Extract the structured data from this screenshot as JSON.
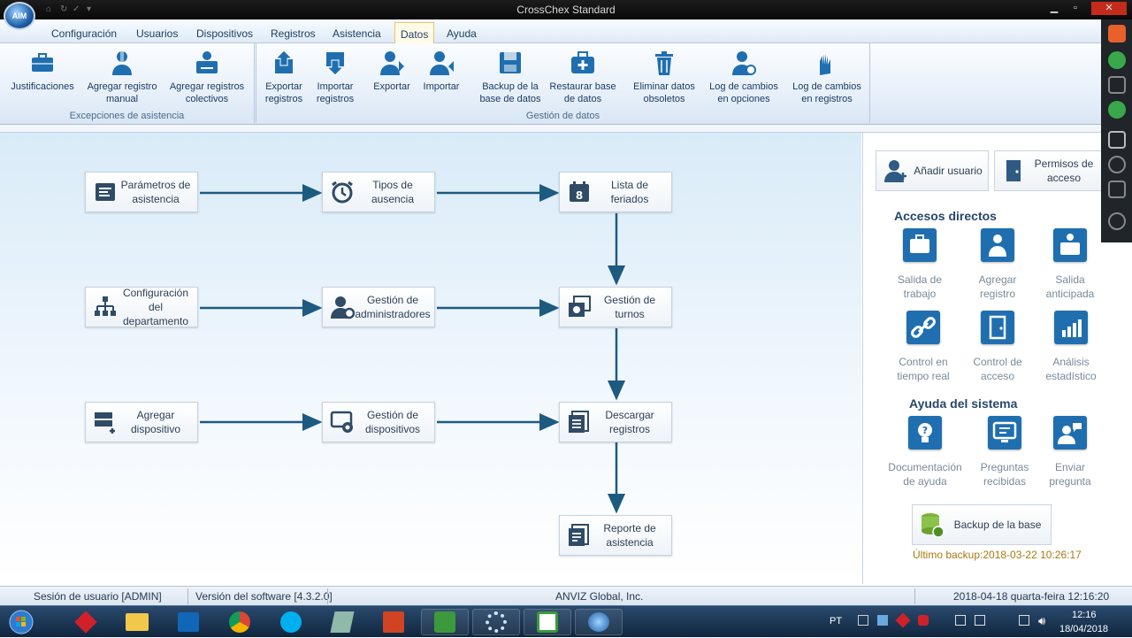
{
  "window": {
    "title": "CrossChex Standard",
    "logo_text": "AIM"
  },
  "menu": {
    "tabs": [
      {
        "label": "Configuración"
      },
      {
        "label": "Usuarios"
      },
      {
        "label": "Dispositivos"
      },
      {
        "label": "Registros"
      },
      {
        "label": "Asistencia"
      },
      {
        "label": "Datos"
      },
      {
        "label": "Ayuda"
      }
    ],
    "active": "Datos"
  },
  "ribbon": {
    "groups": [
      {
        "label": "Excepciones de asistencia"
      },
      {
        "label": "Gestión de datos"
      }
    ],
    "buttons": [
      {
        "label": "Justificaciones"
      },
      {
        "label": "Agregar registro manual"
      },
      {
        "label": "Agregar registros colectivos"
      },
      {
        "label": "Exportar registros"
      },
      {
        "label": "Importar registros"
      },
      {
        "label": "Exportar"
      },
      {
        "label": "Importar"
      },
      {
        "label": "Backup de la base de datos"
      },
      {
        "label": "Restaurar base de datos"
      },
      {
        "label": "Eliminar datos obsoletos"
      },
      {
        "label": "Log de cambios en opciones"
      },
      {
        "label": "Log de cambios en registros"
      }
    ]
  },
  "flow": {
    "nodes": [
      {
        "label": "Parámetros de asistencia",
        "icon": "attendance-params-icon"
      },
      {
        "label": "Tipos de ausencia",
        "icon": "alarm-clock-icon"
      },
      {
        "label": "Lista de feriados",
        "icon": "calendar-icon"
      },
      {
        "label": "Configuración del departamento",
        "icon": "org-chart-icon"
      },
      {
        "label": "Gestión de administradores",
        "icon": "admin-user-icon"
      },
      {
        "label": "Gestión de turnos",
        "icon": "shifts-icon"
      },
      {
        "label": "Agregar dispositivo",
        "icon": "add-device-icon"
      },
      {
        "label": "Gestión de dispositivos",
        "icon": "device-settings-icon"
      },
      {
        "label": "Descargar registros",
        "icon": "download-records-icon"
      },
      {
        "label": "Reporte de asistencia",
        "icon": "report-icon"
      }
    ]
  },
  "panel": {
    "top_buttons": [
      {
        "label": "Añadir usuario"
      },
      {
        "label": "Permisos de acceso"
      }
    ],
    "shortcuts_title": "Accesos directos",
    "shortcuts": [
      {
        "label": "Salida de trabajo"
      },
      {
        "label": "Agregar registro"
      },
      {
        "label": "Salida anticipada"
      },
      {
        "label": "Control en tiempo real"
      },
      {
        "label": "Control de acceso"
      },
      {
        "label": "Análisis estadístico"
      }
    ],
    "help_title": "Ayuda del sistema",
    "help": [
      {
        "label": "Documentación de ayuda"
      },
      {
        "label": "Preguntas recibidas"
      },
      {
        "label": "Enviar pregunta"
      }
    ],
    "backup_label": "Backup de la base",
    "last_backup": "Último backup:2018-03-22 10:26:17"
  },
  "status": {
    "session": "Sesión de usuario  [ADMIN]",
    "version": "Versión del software  [4.3.2.0]",
    "company": "ANVIZ Global, Inc.",
    "datetime": "2018-04-18 quarta-feira 12:16:20"
  },
  "taskbar": {
    "lang": "PT",
    "time": "12:16",
    "date": "18/04/2018"
  },
  "colors": {
    "accent": "#1f6fb0",
    "flow_arrow": "#1d5a80",
    "backup_text": "#a8780f"
  }
}
